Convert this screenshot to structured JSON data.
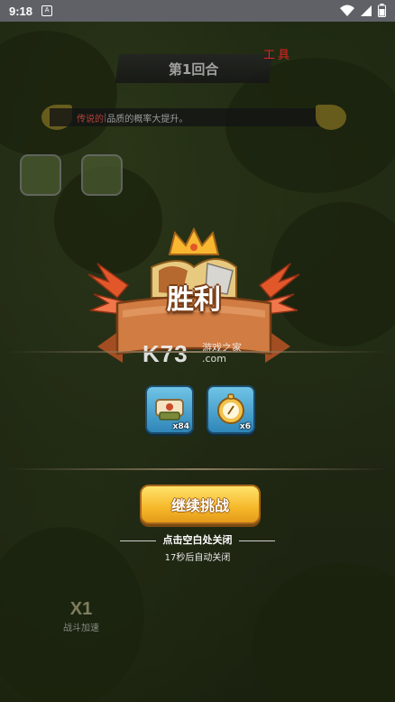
{
  "status_bar": {
    "time": "9:18"
  },
  "header": {
    "round_title": "第1回合",
    "tools_label": "工具"
  },
  "tip": {
    "highlight": "传说的",
    "text": "品质的概率大提升。"
  },
  "victory": {
    "title": "胜利"
  },
  "rewards": [
    {
      "icon": "scroll-bundle-icon",
      "count": "x84"
    },
    {
      "icon": "compass-pocket-watch-icon",
      "count": "x6"
    }
  ],
  "actions": {
    "continue_label": "继续挑战"
  },
  "hints": {
    "close_hint": "点击空白处关闭",
    "auto_close": "17秒后自动关闭"
  },
  "speed": {
    "multiplier": "X1",
    "label": "战斗加速"
  },
  "watermark": {
    "logo": "K73",
    "text": "游戏之家",
    "domain": ".com"
  },
  "colors": {
    "accent_gold": "#f6b72a",
    "ribbon_brown": "#c97a3e",
    "reward_blue": "#3c98c8",
    "tools_red": "#e3221f"
  }
}
